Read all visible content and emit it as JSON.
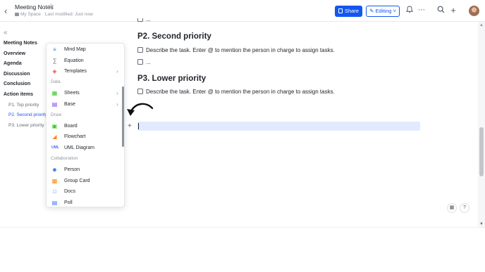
{
  "header": {
    "title": "Meeting Notes",
    "location": "My Space",
    "last_modified": "Last modified: Just now",
    "share_label": "Share",
    "editing_label": "Editing",
    "icons": [
      "back-icon",
      "star-icon",
      "bell-icon",
      "more-icon",
      "search-icon",
      "plus-icon",
      "avatar"
    ]
  },
  "outline": {
    "items": [
      {
        "label": "Meeting Notes",
        "level": 1
      },
      {
        "label": "Overview",
        "level": 1
      },
      {
        "label": "Agenda",
        "level": 1
      },
      {
        "label": "Discussion",
        "level": 1
      },
      {
        "label": "Conclusion",
        "level": 1
      },
      {
        "label": "Action items",
        "level": 1
      },
      {
        "label": "P1. Top priority",
        "level": 2
      },
      {
        "label": "P2. Second priority",
        "level": 2,
        "active": true
      },
      {
        "label": "P3. Lower priority",
        "level": 2
      }
    ]
  },
  "insert_menu": {
    "rows": [
      {
        "label": "Mind Map",
        "icon": "mind-map-icon"
      },
      {
        "label": "Equation",
        "icon": "equation-icon"
      },
      {
        "label": "Templates",
        "icon": "templates-icon",
        "submenu": true
      },
      {
        "category": "Data"
      },
      {
        "label": "Sheets",
        "icon": "sheets-icon",
        "submenu": true
      },
      {
        "label": "Base",
        "icon": "base-icon",
        "submenu": true
      },
      {
        "category": "Draw"
      },
      {
        "label": "Board",
        "icon": "board-icon"
      },
      {
        "label": "Flowchart",
        "icon": "flowchart-icon"
      },
      {
        "label": "UML Diagram",
        "icon": "uml-icon"
      },
      {
        "category": "Collaboration"
      },
      {
        "label": "Person",
        "icon": "person-icon"
      },
      {
        "label": "Group Card",
        "icon": "group-card-icon"
      },
      {
        "label": "Docs",
        "icon": "docs-icon"
      },
      {
        "label": "Poll",
        "icon": "poll-icon"
      }
    ]
  },
  "document": {
    "ellipsis_top": "...",
    "p2_heading": "P2.  Second priority",
    "p2_task": "Describe the task. Enter @ to mention the person in charge to assign tasks.",
    "p2_ellipsis": "...",
    "p3_heading": "P3.  Lower priority",
    "p3_task": "Describe the task. Enter @ to mention the person in charge to assign tasks."
  },
  "colors": {
    "accent": "#1456f0",
    "active_line": "#e1eaff",
    "text": "#1f2329",
    "muted": "#8f959e"
  }
}
